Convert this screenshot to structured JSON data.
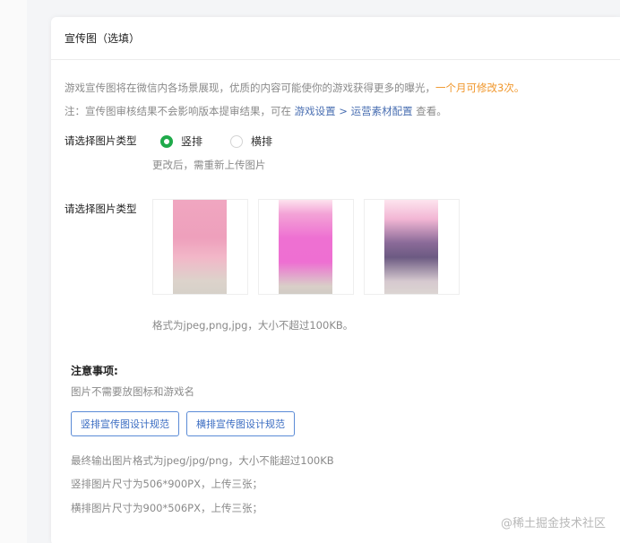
{
  "card": {
    "title": "宣传图（选填）",
    "desc_line1_main": "游戏宣传图将在微信内各场景展现，优质的内容可能使你的游戏获得更多的曝光，",
    "desc_line1_highlight": "一个月可修改3次。",
    "desc_line2_prefix": "注：宣传图审核结果不会影响版本提审结果，可在",
    "desc_line2_link": "游戏设置 > 运营素材配置",
    "desc_line2_suffix": "查看。"
  },
  "image_type": {
    "label": "请选择图片类型",
    "options": [
      {
        "label": "竖排",
        "selected": true
      },
      {
        "label": "横排",
        "selected": false
      }
    ],
    "hint": "更改后，需重新上传图片"
  },
  "images": {
    "label": "请选择图片类型",
    "format_hint": "格式为jpeg,png,jpg，大小不超过100KB。"
  },
  "notice": {
    "title": "注意事项:",
    "text": "图片不需要放图标和游戏名",
    "buttons": [
      "竖排宣传图设计规范",
      "横排宣传图设计规范"
    ],
    "specs": [
      "最终输出图片格式为jpeg/jpg/png，大小不能超过100KB",
      "竖排图片尺寸为506*900PX，上传三张；",
      "横排图片尺寸为900*506PX，上传三张；"
    ]
  },
  "watermark": "@稀土掘金技术社区",
  "colors": {
    "accent_green": "#1faa4a",
    "highlight_orange": "#f0962a",
    "link_blue": "#4a6fb2",
    "button_blue": "#3a6cc2"
  }
}
